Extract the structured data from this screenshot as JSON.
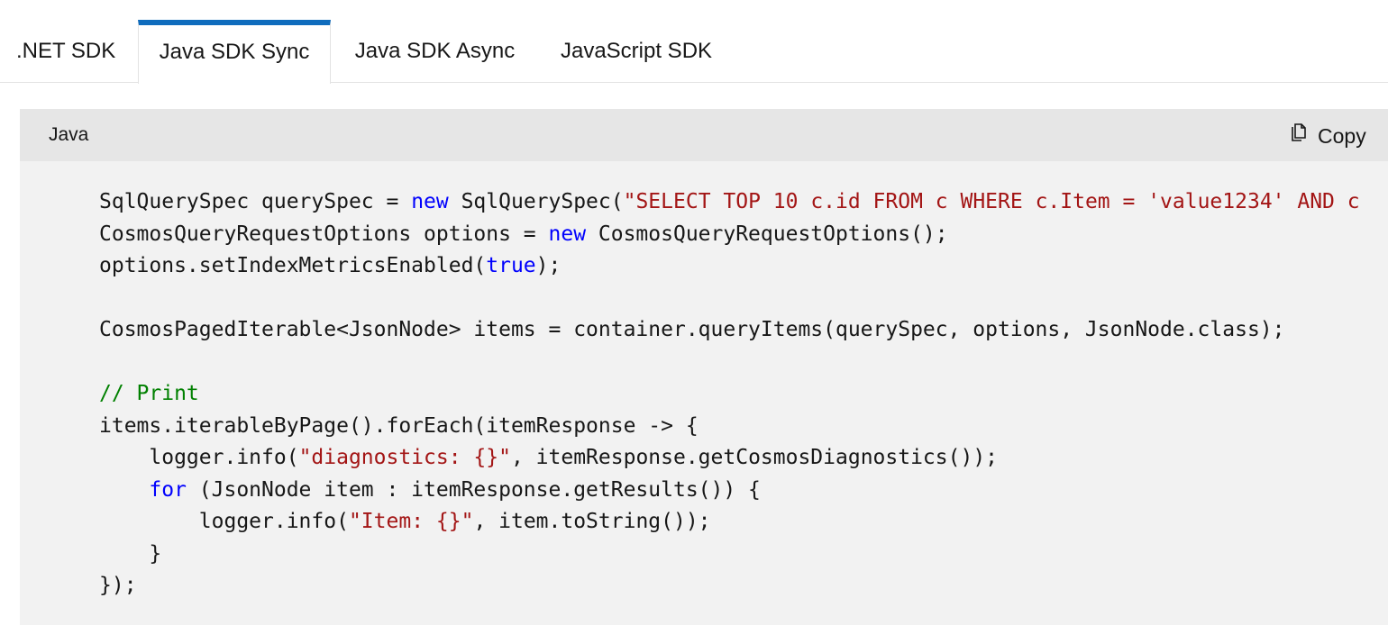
{
  "tabs": [
    {
      "label": ".NET SDK",
      "active": false
    },
    {
      "label": "Java SDK Sync",
      "active": true
    },
    {
      "label": "Java SDK Async",
      "active": false
    },
    {
      "label": "JavaScript SDK",
      "active": false
    }
  ],
  "code_block": {
    "language": "Java",
    "copy_label": "Copy",
    "copy_icon": "copy-icon",
    "colors": {
      "active_tab_accent": "#0f6cbd",
      "keyword": "#0101fd",
      "string": "#a31515",
      "comment": "#008000"
    },
    "lines": [
      [
        {
          "t": "SqlQuerySpec querySpec = ",
          "c": "plain"
        },
        {
          "t": "new",
          "c": "kw"
        },
        {
          "t": " SqlQuerySpec(",
          "c": "plain"
        },
        {
          "t": "\"SELECT TOP 10 c.id FROM c WHERE c.Item = 'value1234' AND c",
          "c": "str"
        }
      ],
      [
        {
          "t": "CosmosQueryRequestOptions options = ",
          "c": "plain"
        },
        {
          "t": "new",
          "c": "kw"
        },
        {
          "t": " CosmosQueryRequestOptions();",
          "c": "plain"
        }
      ],
      [
        {
          "t": "options.setIndexMetricsEnabled(",
          "c": "plain"
        },
        {
          "t": "true",
          "c": "kw"
        },
        {
          "t": ");",
          "c": "plain"
        }
      ],
      [],
      [
        {
          "t": "CosmosPagedIterable<JsonNode> items = container.queryItems(querySpec, options, JsonNode.class);",
          "c": "plain"
        }
      ],
      [],
      [
        {
          "t": "// Print",
          "c": "cmt"
        }
      ],
      [
        {
          "t": "items.iterableByPage().forEach(itemResponse -> {",
          "c": "plain"
        }
      ],
      [
        {
          "t": "    logger.info(",
          "c": "plain"
        },
        {
          "t": "\"diagnostics: {}\"",
          "c": "str"
        },
        {
          "t": ", itemResponse.getCosmosDiagnostics());",
          "c": "plain"
        }
      ],
      [
        {
          "t": "    ",
          "c": "plain"
        },
        {
          "t": "for",
          "c": "kw"
        },
        {
          "t": " (JsonNode item : itemResponse.getResults()) {",
          "c": "plain"
        }
      ],
      [
        {
          "t": "        logger.info(",
          "c": "plain"
        },
        {
          "t": "\"Item: {}\"",
          "c": "str"
        },
        {
          "t": ", item.toString());",
          "c": "plain"
        }
      ],
      [
        {
          "t": "    }",
          "c": "plain"
        }
      ],
      [
        {
          "t": "});",
          "c": "plain"
        }
      ]
    ]
  }
}
